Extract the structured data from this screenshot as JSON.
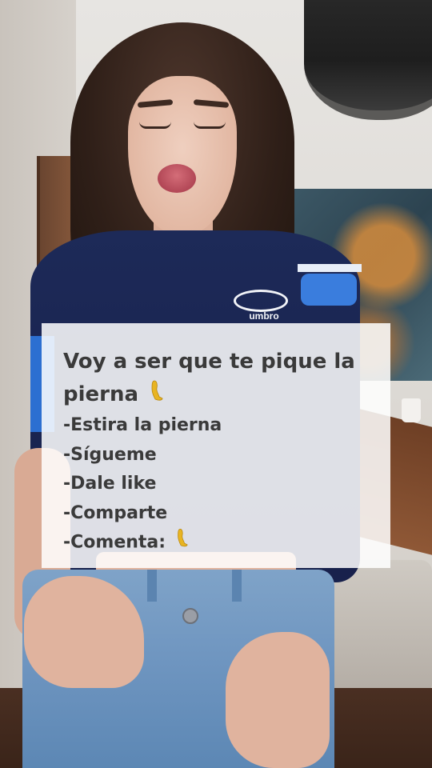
{
  "caption": {
    "title_line1": "Voy a ser que te pique la",
    "title_line2": "pierna",
    "emoji": "leg-icon",
    "items": [
      "-Estira la pierna",
      "-Sígueme",
      "-Dale like",
      "-Comparte",
      "-Comenta:"
    ]
  },
  "shirt": {
    "brand_text": "umbro"
  },
  "colors": {
    "caption_bg": "#ffffffdb",
    "caption_text": "#3a3a3a",
    "shirt_navy": "#1a2552",
    "shirt_blue": "#2c6fd1",
    "emoji_gold": "#e8b422"
  }
}
